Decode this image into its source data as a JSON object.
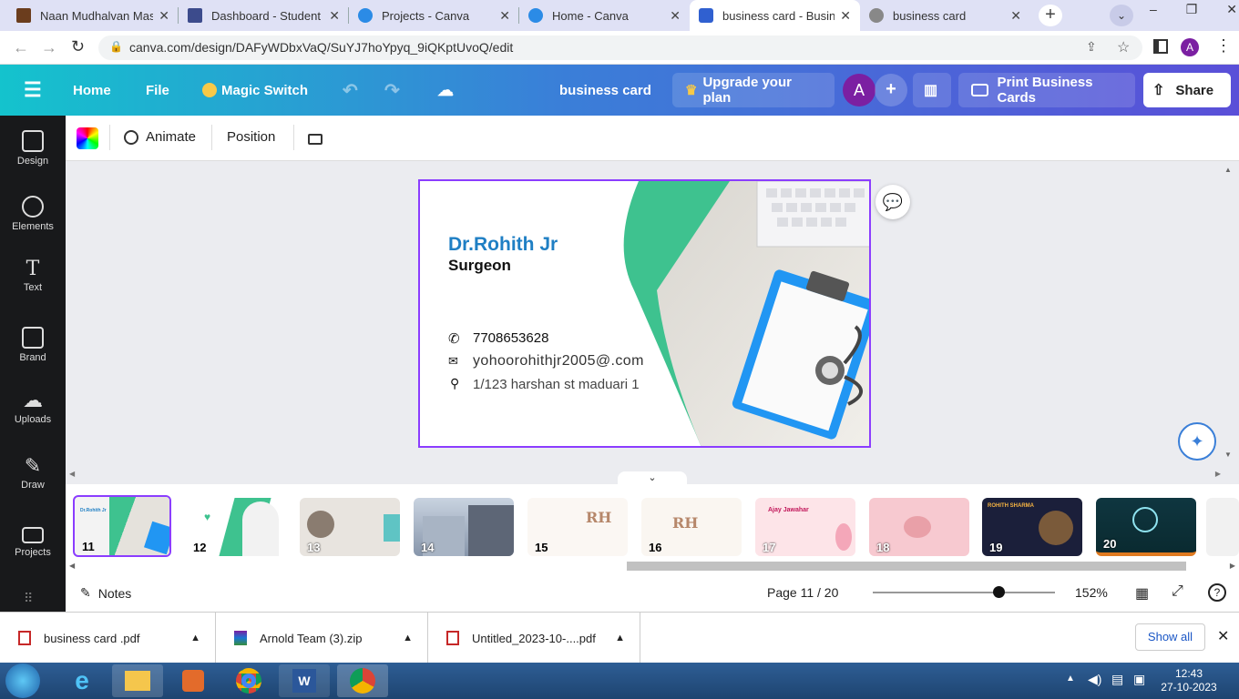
{
  "browser": {
    "tabs": [
      {
        "title": "Naan Mudhalvan Mass",
        "color": "#6b3d1d"
      },
      {
        "title": "Dashboard - Student",
        "color": "#3c4b8c"
      },
      {
        "title": "Projects - Canva",
        "color": "#2b8be6"
      },
      {
        "title": "Home - Canva",
        "color": "#2b8be6"
      },
      {
        "title": "business card - Busines",
        "color": "#3060d0"
      },
      {
        "title": "business card",
        "color": "#888888"
      }
    ],
    "url": "canva.com/design/DAFyWDbxVaQ/SuYJ7hoYpyq_9iQKptUvoQ/edit",
    "profile_initial": "A"
  },
  "header": {
    "home": "Home",
    "file": "File",
    "magic_switch": "Magic Switch",
    "doc_title": "business card",
    "upgrade": "Upgrade your plan",
    "avatar": "A",
    "print": "Print Business Cards",
    "share": "Share"
  },
  "sidebar": [
    {
      "label": "Design"
    },
    {
      "label": "Elements"
    },
    {
      "label": "Text"
    },
    {
      "label": "Brand"
    },
    {
      "label": "Uploads"
    },
    {
      "label": "Draw"
    },
    {
      "label": "Projects"
    }
  ],
  "toolbar": {
    "animate": "Animate",
    "position": "Position"
  },
  "card": {
    "name": "Dr.Rohith Jr",
    "role": "Surgeon",
    "phone": "7708653628",
    "email": "yohoorohithjr2005@.com",
    "address": "1/123 harshan st maduari 1",
    "accent": "#1f7fc4",
    "green": "#3ec28f"
  },
  "pages": [
    {
      "num": "11",
      "bg": "#ffffff"
    },
    {
      "num": "12",
      "bg": "#ffffff"
    },
    {
      "num": "13",
      "bg": "#e8e4df"
    },
    {
      "num": "14",
      "bg": "#b9c4d2"
    },
    {
      "num": "15",
      "bg": "#fbf7f3"
    },
    {
      "num": "16",
      "bg": "#faf6f1"
    },
    {
      "num": "17",
      "bg": "#fde4e8"
    },
    {
      "num": "18",
      "bg": "#f7c9d0"
    },
    {
      "num": "19",
      "bg": "#1b1f3a"
    },
    {
      "num": "20",
      "bg": "#0f3640"
    }
  ],
  "footer": {
    "notes": "Notes",
    "page": "Page 11 / 20",
    "zoom": "152%"
  },
  "downloads": [
    {
      "name": "business card .pdf"
    },
    {
      "name": "Arnold Team (3).zip"
    },
    {
      "name": "Untitled_2023-10-....pdf"
    }
  ],
  "show_all": "Show all",
  "clock": {
    "time": "12:43",
    "date": "27-10-2023"
  }
}
